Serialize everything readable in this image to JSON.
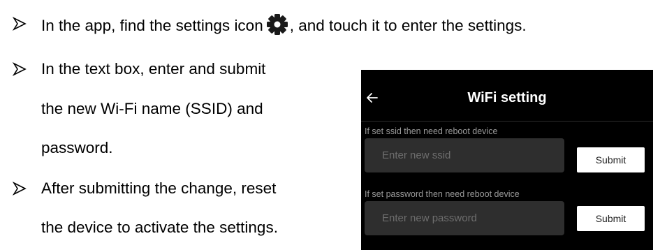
{
  "instructions": [
    {
      "text_before_icon": "In the app, find the settings icon",
      "icon": "gear-icon",
      "text_after_icon": ", and touch it to enter the settings."
    },
    {
      "lines": [
        "In the text box, enter and submit",
        "the new Wi-Fi name (SSID) and",
        "password."
      ]
    },
    {
      "lines": [
        "After submitting the change, reset",
        "the device to activate the settings."
      ]
    }
  ],
  "screen": {
    "back_icon": "arrow-left-icon",
    "title": "WiFi setting",
    "ssid": {
      "hint": "If set ssid then need reboot device",
      "placeholder": "Enter new ssid",
      "value": "",
      "submit_label": "Submit"
    },
    "password": {
      "hint": "If set password then need reboot device",
      "placeholder": "Enter new password",
      "value": "",
      "submit_label": "Submit"
    }
  },
  "colors": {
    "screen_bg": "#000000",
    "field_bg": "#2e2e2e",
    "hint_text": "#9a9a9a",
    "button_bg": "#ffffff"
  }
}
